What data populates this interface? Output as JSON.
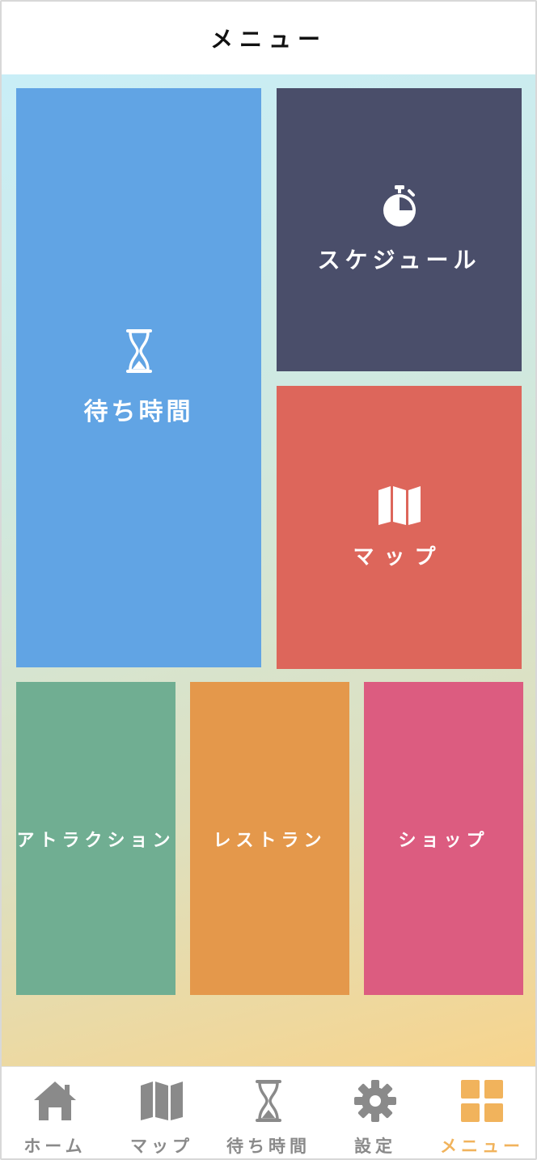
{
  "header": {
    "title": "メニュー"
  },
  "tiles": {
    "wait_times": {
      "label": "待ち時間",
      "icon": "hourglass-icon",
      "color": "#61a4e4"
    },
    "schedule": {
      "label": "スケジュール",
      "icon": "stopwatch-icon",
      "color": "#4a4e6a"
    },
    "map": {
      "label": "マップ",
      "icon": "map-icon",
      "color": "#dd665b"
    },
    "attraction": {
      "label": "アトラクション",
      "color": "#70ae92"
    },
    "restaurant": {
      "label": "レストラン",
      "color": "#e4984b"
    },
    "shop": {
      "label": "ショップ",
      "color": "#dc5c80"
    }
  },
  "tabbar": {
    "active": "menu",
    "active_color": "#f1b35c",
    "inactive_color": "#8a8a8a",
    "items": [
      {
        "id": "home",
        "label": "ホーム",
        "icon": "home-icon"
      },
      {
        "id": "map",
        "label": "マップ",
        "icon": "map-icon"
      },
      {
        "id": "wait",
        "label": "待ち時間",
        "icon": "hourglass-icon"
      },
      {
        "id": "settings",
        "label": "設定",
        "icon": "gear-icon"
      },
      {
        "id": "menu",
        "label": "メニュー",
        "icon": "grid-icon"
      }
    ]
  }
}
